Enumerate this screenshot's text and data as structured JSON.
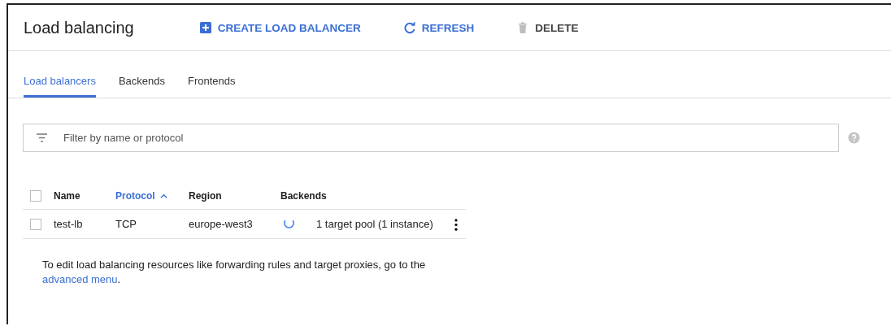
{
  "header": {
    "title": "Load balancing",
    "actions": [
      {
        "kind": "create",
        "label": "CREATE LOAD BALANCER",
        "disabled": false
      },
      {
        "kind": "refresh",
        "label": "REFRESH",
        "disabled": false
      },
      {
        "kind": "delete",
        "label": "DELETE",
        "disabled": true
      }
    ]
  },
  "tabs": [
    {
      "label": "Load balancers",
      "selected": true
    },
    {
      "label": "Backends",
      "selected": false
    },
    {
      "label": "Frontends",
      "selected": false
    }
  ],
  "filter": {
    "placeholder": "Filter by name or protocol"
  },
  "table": {
    "select_all_checked": false,
    "columns": [
      {
        "label": "Name",
        "sorted": false
      },
      {
        "label": "Protocol",
        "sorted": true
      },
      {
        "label": "Region",
        "sorted": false
      },
      {
        "label": "Backends",
        "sorted": false
      }
    ],
    "rows": [
      {
        "checked": false,
        "name": "test-lb",
        "protocol": "TCP",
        "region": "europe-west3",
        "backends": "1 target pool (1 instance)"
      }
    ]
  },
  "note": {
    "text": "To edit load balancing resources like forwarding rules and target proxies, go to the",
    "link": "advanced menu",
    "after": "."
  }
}
